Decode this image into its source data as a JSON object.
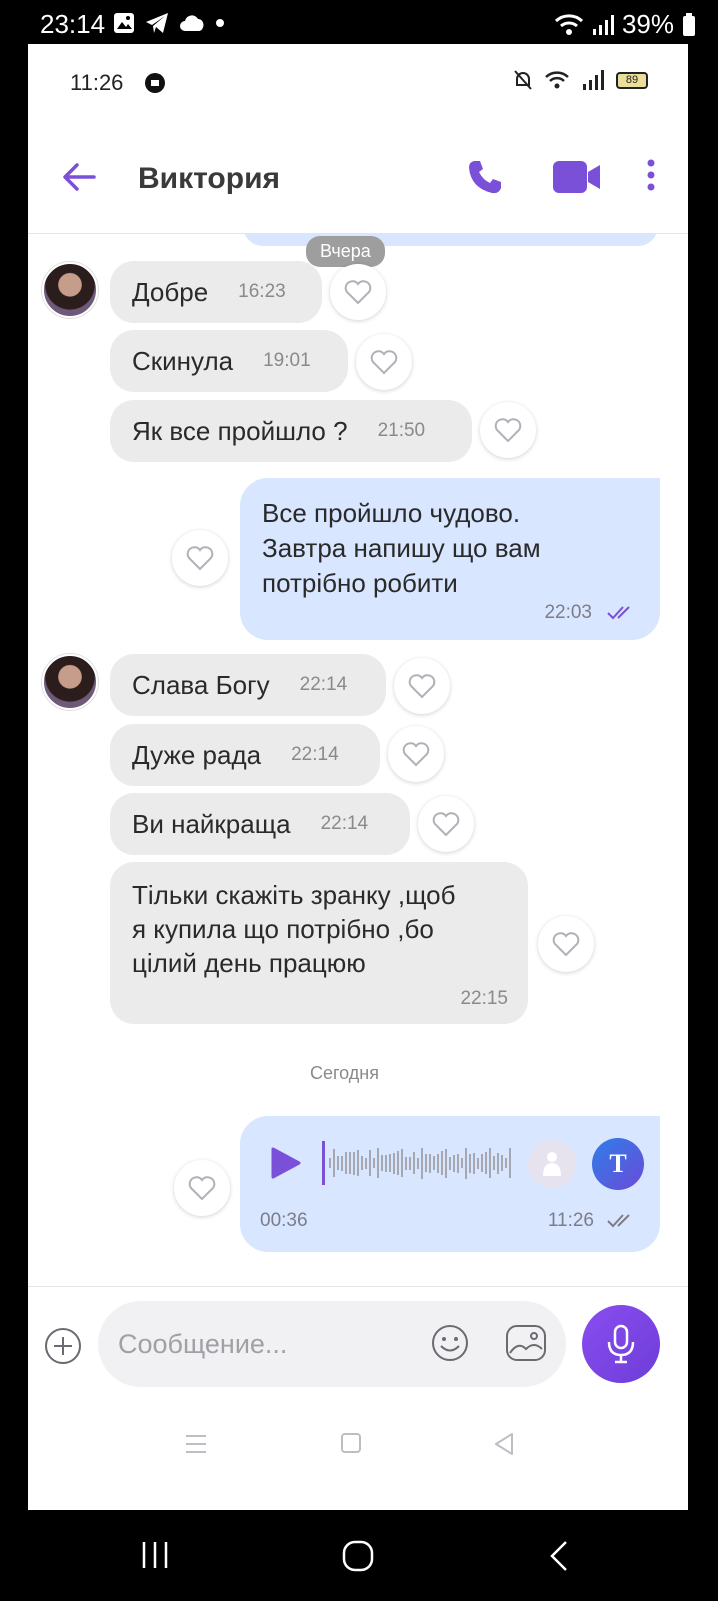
{
  "outer_status": {
    "time": "23:14",
    "battery": "39%"
  },
  "inner_status": {
    "time": "11:26",
    "battery": "89"
  },
  "header": {
    "contact_name": "Виктория"
  },
  "chat": {
    "day_yesterday": "Вчера",
    "day_today": "Сегодня",
    "incoming_group1": [
      {
        "text": "Добре",
        "time": "16:23"
      },
      {
        "text": "Скинула",
        "time": "19:01"
      },
      {
        "text": "Як все пройшло ?",
        "time": "21:50"
      }
    ],
    "outgoing1": {
      "lines": [
        "Все пройшло чудово.",
        "Завтра напишу що вам",
        "потрібно робити"
      ],
      "time": "22:03"
    },
    "incoming_group2": [
      {
        "text": "Слава Богу",
        "time": "22:14"
      },
      {
        "text": "Дуже рада",
        "time": "22:14"
      },
      {
        "text": "Ви найкраща",
        "time": "22:14"
      }
    ],
    "incoming_long": {
      "lines": [
        "Тільки скажіть зранку ,щоб",
        "я купила  що потрібно ,бо",
        "цілий день працюю"
      ],
      "time": "22:15"
    },
    "voice_message": {
      "duration": "00:36",
      "time": "11:26",
      "transcribe_label": "T"
    }
  },
  "composer": {
    "placeholder": "Сообщение..."
  },
  "colors": {
    "accent": "#7a50d8",
    "outgoing_bubble": "#d8e6ff",
    "incoming_bubble": "#ebebeb"
  }
}
